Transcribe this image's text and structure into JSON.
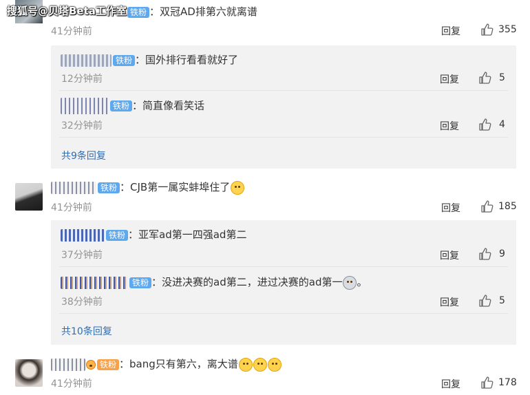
{
  "watermark": "搜狐号@贝塔Beta工作室",
  "badge_label": "铁粉",
  "reply_label": "回复",
  "colon": "：",
  "comments": [
    {
      "text": "双冠AD排第六就离谱",
      "time": "41分钟前",
      "likes": "355",
      "replies": [
        {
          "text": "国外排行看看就好了",
          "time": "12分钟前",
          "likes": "5"
        },
        {
          "text": "简直像看笑话",
          "time": "32分钟前",
          "likes": "4"
        }
      ],
      "more": "共9条回复"
    },
    {
      "text": "CJB第一属实蚌埠住了",
      "time": "41分钟前",
      "likes": "185",
      "replies": [
        {
          "text": "亚军ad第一四强ad第二",
          "time": "37分钟前",
          "likes": "9"
        },
        {
          "text": "没进决赛的ad第二，进过决赛的ad第一",
          "suffix": "。",
          "time": "38分钟前",
          "likes": "5"
        }
      ],
      "more": "共10条回复"
    },
    {
      "text": "bang只有第六，离大谱",
      "time": "41分钟前",
      "likes": "178",
      "replies": []
    }
  ]
}
